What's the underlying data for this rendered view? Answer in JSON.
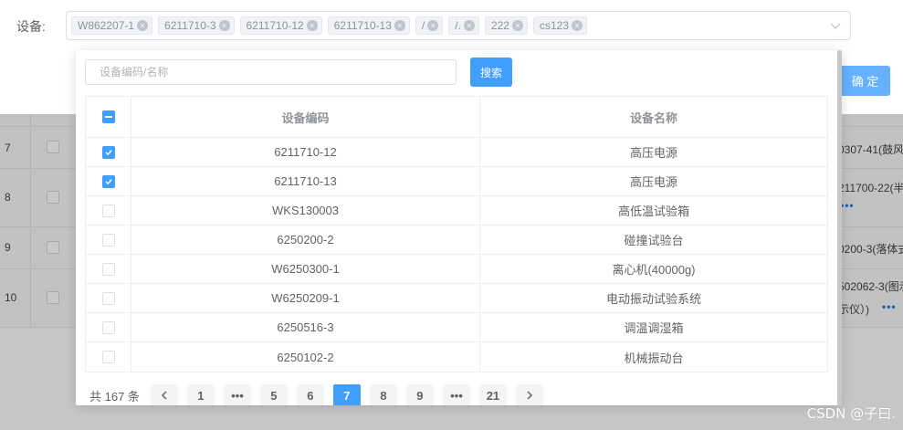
{
  "form": {
    "label": "设备:",
    "tags": [
      "W862207-1",
      "6211710-3",
      "6211710-12",
      "6211710-13",
      "/",
      "/.",
      "222",
      "cs123"
    ],
    "confirm_label": "确 定"
  },
  "background_rows": [
    {
      "index": "7",
      "text": "0307-41(鼓风",
      "more": ""
    },
    {
      "index": "8",
      "text": "211700-22(半",
      "more": "•••"
    },
    {
      "index": "9",
      "text": "0200-3(落体式",
      "more": ""
    },
    {
      "index": "10",
      "text": "502062-3(图示",
      "text2": "示仪）)",
      "more": "•••"
    }
  ],
  "dropdown": {
    "search_placeholder": "设备编码/名称",
    "search_button": "搜索",
    "columns": {
      "code": "设备编码",
      "name": "设备名称"
    },
    "rows": [
      {
        "code": "6211710-12",
        "name": "高压电源",
        "checked": true
      },
      {
        "code": "6211710-13",
        "name": "高压电源",
        "checked": true
      },
      {
        "code": "WKS130003",
        "name": "高低温试验箱",
        "checked": false
      },
      {
        "code": "6250200-2",
        "name": "碰撞试验台",
        "checked": false
      },
      {
        "code": "W6250300-1",
        "name": "离心机(40000g)",
        "checked": false
      },
      {
        "code": "W6250209-1",
        "name": "电动振动试验系统",
        "checked": false
      },
      {
        "code": "6250516-3",
        "name": "调温调湿箱",
        "checked": false
      },
      {
        "code": "6250102-2",
        "name": "机械振动台",
        "checked": false
      }
    ],
    "pagination": {
      "total": "共 167 条",
      "pages": [
        "1",
        "•••",
        "5",
        "6",
        "7",
        "8",
        "9",
        "•••",
        "21"
      ],
      "current": "7"
    }
  },
  "colors": {
    "primary": "#409eff",
    "confirm": "#66b1ff"
  },
  "watermark": "CSDN @子曰."
}
